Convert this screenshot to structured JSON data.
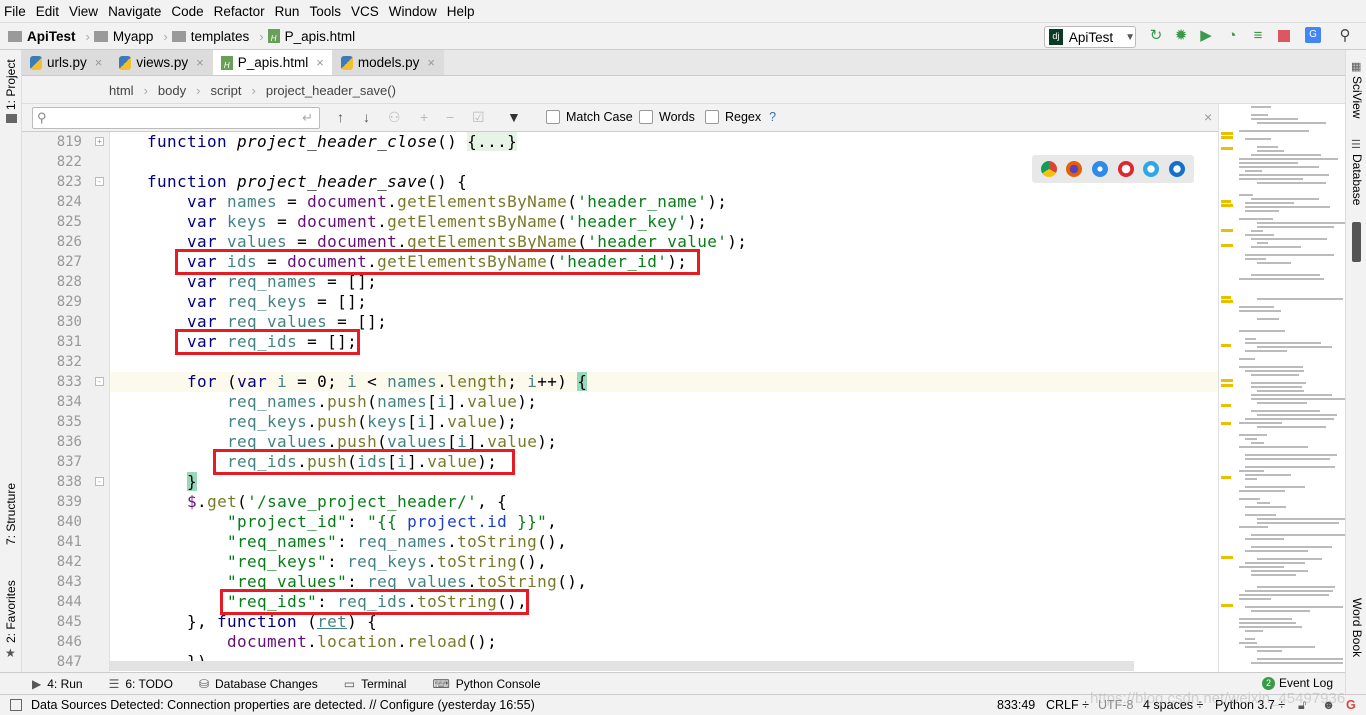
{
  "menu": [
    "File",
    "Edit",
    "View",
    "Navigate",
    "Code",
    "Refactor",
    "Run",
    "Tools",
    "VCS",
    "Window",
    "Help"
  ],
  "nav": {
    "project": "ApiTest",
    "folder1": "Myapp",
    "folder2": "templates",
    "file": "P_apis.html"
  },
  "run_config": {
    "label": "ApiTest",
    "icon": "django-icon"
  },
  "tabs": [
    {
      "label": "urls.py",
      "active": false
    },
    {
      "label": "views.py",
      "active": false
    },
    {
      "label": "P_apis.html",
      "active": true
    },
    {
      "label": "models.py",
      "active": false
    }
  ],
  "breadcrumb": [
    "html",
    "body",
    "script",
    "project_header_save()"
  ],
  "find": {
    "value": "",
    "match_case": "Match Case",
    "words": "Words",
    "regex": "Regex",
    "help": "?"
  },
  "side_left": [
    "1: Project",
    "7: Structure",
    "2: Favorites"
  ],
  "side_right": [
    "SciView",
    "Database",
    "Word Book"
  ],
  "colors": {
    "keyword": "#000080",
    "variable": "#458383",
    "document": "#660e7a",
    "method": "#7a7a2b",
    "string": "#067d17",
    "highlight_box": "#e51c23"
  },
  "code": {
    "current_line": "833",
    "highlighted_lines": [
      "827",
      "831",
      "837",
      "844"
    ],
    "lines": [
      {
        "n": "819",
        "fold": "+",
        "tokens": [
          [
            "p",
            "    "
          ],
          [
            "k",
            "function "
          ],
          [
            "f",
            "project_header_close"
          ],
          [
            "p",
            "() "
          ],
          [
            "fold",
            "{...}"
          ]
        ]
      },
      {
        "n": "822",
        "tokens": []
      },
      {
        "n": "823",
        "fold": "-",
        "tokens": [
          [
            "p",
            "    "
          ],
          [
            "k",
            "function "
          ],
          [
            "f",
            "project_header_save"
          ],
          [
            "p",
            "() {"
          ]
        ]
      },
      {
        "n": "824",
        "tokens": [
          [
            "p",
            "        "
          ],
          [
            "k",
            "var "
          ],
          [
            "v",
            "names"
          ],
          [
            "p",
            " = "
          ],
          [
            "d",
            "document"
          ],
          [
            "p",
            "."
          ],
          [
            "m",
            "getElementsByName"
          ],
          [
            "p",
            "("
          ],
          [
            "s",
            "'header_name'"
          ],
          [
            "p",
            ");"
          ]
        ]
      },
      {
        "n": "825",
        "tokens": [
          [
            "p",
            "        "
          ],
          [
            "k",
            "var "
          ],
          [
            "v",
            "keys"
          ],
          [
            "p",
            " = "
          ],
          [
            "d",
            "document"
          ],
          [
            "p",
            "."
          ],
          [
            "m",
            "getElementsByName"
          ],
          [
            "p",
            "("
          ],
          [
            "s",
            "'header_key'"
          ],
          [
            "p",
            ");"
          ]
        ]
      },
      {
        "n": "826",
        "tokens": [
          [
            "p",
            "        "
          ],
          [
            "k",
            "var "
          ],
          [
            "v",
            "values"
          ],
          [
            "p",
            " = "
          ],
          [
            "d",
            "document"
          ],
          [
            "p",
            "."
          ],
          [
            "m",
            "getElementsByName"
          ],
          [
            "p",
            "("
          ],
          [
            "s",
            "'header_value'"
          ],
          [
            "p",
            ");"
          ]
        ]
      },
      {
        "n": "827",
        "tokens": [
          [
            "p",
            "        "
          ],
          [
            "k",
            "var "
          ],
          [
            "v",
            "ids"
          ],
          [
            "p",
            " = "
          ],
          [
            "d",
            "document"
          ],
          [
            "p",
            "."
          ],
          [
            "m",
            "getElementsByName"
          ],
          [
            "p",
            "("
          ],
          [
            "s",
            "'header_id'"
          ],
          [
            "p",
            ");"
          ]
        ]
      },
      {
        "n": "828",
        "tokens": [
          [
            "p",
            "        "
          ],
          [
            "k",
            "var "
          ],
          [
            "v",
            "req_names"
          ],
          [
            "p",
            " = [];"
          ]
        ]
      },
      {
        "n": "829",
        "tokens": [
          [
            "p",
            "        "
          ],
          [
            "k",
            "var "
          ],
          [
            "v",
            "req_keys"
          ],
          [
            "p",
            " = [];"
          ]
        ]
      },
      {
        "n": "830",
        "tokens": [
          [
            "p",
            "        "
          ],
          [
            "k",
            "var "
          ],
          [
            "v",
            "req_values"
          ],
          [
            "p",
            " = [];"
          ]
        ]
      },
      {
        "n": "831",
        "tokens": [
          [
            "p",
            "        "
          ],
          [
            "k",
            "var "
          ],
          [
            "v",
            "req_ids"
          ],
          [
            "p",
            " = [];"
          ]
        ]
      },
      {
        "n": "832",
        "tokens": []
      },
      {
        "n": "833",
        "fold": "-",
        "tokens": [
          [
            "p",
            "        "
          ],
          [
            "k",
            "for "
          ],
          [
            "p",
            "("
          ],
          [
            "k",
            "var "
          ],
          [
            "v",
            "i"
          ],
          [
            "p",
            " = 0; "
          ],
          [
            "v",
            "i"
          ],
          [
            "p",
            " < "
          ],
          [
            "v",
            "names"
          ],
          [
            "p",
            "."
          ],
          [
            "m",
            "length"
          ],
          [
            "p",
            "; "
          ],
          [
            "v",
            "i"
          ],
          [
            "p",
            "++) "
          ],
          [
            "b",
            "{"
          ]
        ]
      },
      {
        "n": "834",
        "tokens": [
          [
            "p",
            "            "
          ],
          [
            "v",
            "req_names"
          ],
          [
            "p",
            "."
          ],
          [
            "m",
            "push"
          ],
          [
            "p",
            "("
          ],
          [
            "v",
            "names"
          ],
          [
            "p",
            "["
          ],
          [
            "v",
            "i"
          ],
          [
            "p",
            "]."
          ],
          [
            "m",
            "value"
          ],
          [
            "p",
            ");"
          ]
        ]
      },
      {
        "n": "835",
        "tokens": [
          [
            "p",
            "            "
          ],
          [
            "v",
            "req_keys"
          ],
          [
            "p",
            "."
          ],
          [
            "m",
            "push"
          ],
          [
            "p",
            "("
          ],
          [
            "v",
            "keys"
          ],
          [
            "p",
            "["
          ],
          [
            "v",
            "i"
          ],
          [
            "p",
            "]."
          ],
          [
            "m",
            "value"
          ],
          [
            "p",
            ");"
          ]
        ]
      },
      {
        "n": "836",
        "tokens": [
          [
            "p",
            "            "
          ],
          [
            "v",
            "req_values"
          ],
          [
            "p",
            "."
          ],
          [
            "m",
            "push"
          ],
          [
            "p",
            "("
          ],
          [
            "v",
            "values"
          ],
          [
            "p",
            "["
          ],
          [
            "v",
            "i"
          ],
          [
            "p",
            "]."
          ],
          [
            "m",
            "value"
          ],
          [
            "p",
            ");"
          ]
        ]
      },
      {
        "n": "837",
        "tokens": [
          [
            "p",
            "            "
          ],
          [
            "v",
            "req_ids"
          ],
          [
            "p",
            "."
          ],
          [
            "m",
            "push"
          ],
          [
            "p",
            "("
          ],
          [
            "v",
            "ids"
          ],
          [
            "p",
            "["
          ],
          [
            "v",
            "i"
          ],
          [
            "p",
            "]."
          ],
          [
            "m",
            "value"
          ],
          [
            "p",
            ");"
          ]
        ]
      },
      {
        "n": "838",
        "fold": "-",
        "tokens": [
          [
            "p",
            "        "
          ],
          [
            "b",
            "}"
          ]
        ]
      },
      {
        "n": "839",
        "tokens": [
          [
            "p",
            "        "
          ],
          [
            "d",
            "$"
          ],
          [
            "p",
            "."
          ],
          [
            "m",
            "get"
          ],
          [
            "p",
            "("
          ],
          [
            "s",
            "'/save_project_header/'"
          ],
          [
            "p",
            ", {"
          ]
        ]
      },
      {
        "n": "840",
        "tokens": [
          [
            "p",
            "            "
          ],
          [
            "s",
            "\"project_id\""
          ],
          [
            "p",
            ": "
          ],
          [
            "s",
            "\"{{ "
          ],
          [
            "t",
            "project.id"
          ],
          [
            "s",
            " }}\""
          ],
          [
            "p",
            ","
          ]
        ]
      },
      {
        "n": "841",
        "tokens": [
          [
            "p",
            "            "
          ],
          [
            "s",
            "\"req_names\""
          ],
          [
            "p",
            ": "
          ],
          [
            "v",
            "req_names"
          ],
          [
            "p",
            "."
          ],
          [
            "m",
            "toString"
          ],
          [
            "p",
            "(),"
          ]
        ]
      },
      {
        "n": "842",
        "tokens": [
          [
            "p",
            "            "
          ],
          [
            "s",
            "\"req_keys\""
          ],
          [
            "p",
            ": "
          ],
          [
            "v",
            "req_keys"
          ],
          [
            "p",
            "."
          ],
          [
            "m",
            "toString"
          ],
          [
            "p",
            "(),"
          ]
        ]
      },
      {
        "n": "843",
        "tokens": [
          [
            "p",
            "            "
          ],
          [
            "s",
            "\"req_values\""
          ],
          [
            "p",
            ": "
          ],
          [
            "v",
            "req_values"
          ],
          [
            "p",
            "."
          ],
          [
            "m",
            "toString"
          ],
          [
            "p",
            "(),"
          ]
        ]
      },
      {
        "n": "844",
        "tokens": [
          [
            "p",
            "            "
          ],
          [
            "s",
            "\"req_ids\""
          ],
          [
            "p",
            ": "
          ],
          [
            "v",
            "req_ids"
          ],
          [
            "p",
            "."
          ],
          [
            "m",
            "toString"
          ],
          [
            "p",
            "(),"
          ]
        ]
      },
      {
        "n": "845",
        "tokens": [
          [
            "p",
            "        }, "
          ],
          [
            "k",
            "function "
          ],
          [
            "p",
            "("
          ],
          [
            "u",
            "ret"
          ],
          [
            "p",
            ") {"
          ]
        ]
      },
      {
        "n": "846",
        "tokens": [
          [
            "p",
            "            "
          ],
          [
            "d",
            "document"
          ],
          [
            "p",
            "."
          ],
          [
            "m",
            "location"
          ],
          [
            "p",
            "."
          ],
          [
            "m",
            "reload"
          ],
          [
            "p",
            "();"
          ]
        ]
      },
      {
        "n": "847",
        "tokens": [
          [
            "p",
            "        })"
          ]
        ]
      }
    ]
  },
  "browsers": [
    "chrome-icon",
    "firefox-icon",
    "safari-icon",
    "opera-icon",
    "ie-icon",
    "edge-icon"
  ],
  "toolwindows": [
    {
      "icon": "run-icon",
      "label": "4: Run"
    },
    {
      "icon": "todo-icon",
      "label": "6: TODO"
    },
    {
      "icon": "database-changes-icon",
      "label": "Database Changes"
    },
    {
      "icon": "terminal-icon",
      "label": "Terminal"
    },
    {
      "icon": "python-console-icon",
      "label": "Python Console"
    }
  ],
  "event_log": {
    "count": "2",
    "label": "Event Log"
  },
  "status": {
    "message": "Data Sources Detected: Connection properties are detected. // Configure (yesterday 16:55)",
    "position": "833:49",
    "line_sep": "CRLF ÷",
    "encoding": "UTF-8",
    "indent": "4 spaces ÷",
    "interpreter": "Python 3.7 ÷"
  },
  "watermark": "https://blog.csdn.net/weixin_45497936"
}
